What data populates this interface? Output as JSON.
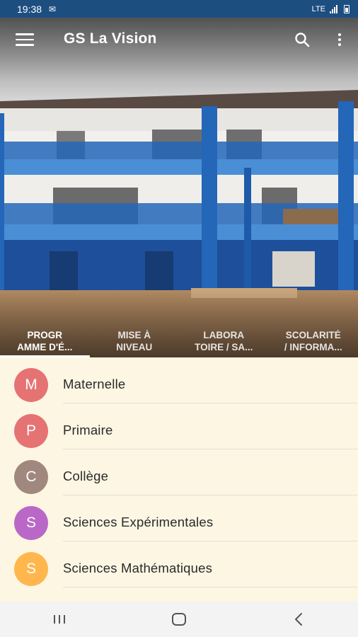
{
  "status_bar": {
    "time": "19:38",
    "notification_icon": "mail-icon",
    "network": "LTE"
  },
  "app_bar": {
    "title": "GS La Vision",
    "menu_icon": "menu-icon",
    "search_icon": "search-icon",
    "more_icon": "more-vert-icon"
  },
  "tabs": [
    {
      "line1": "PROGR",
      "line2": "AMME D'É...",
      "active": true
    },
    {
      "line1": "MISE À",
      "line2": "NIVEAU",
      "active": false
    },
    {
      "line1": "LABORA",
      "line2": "TOIRE / SA...",
      "active": false
    },
    {
      "line1": "SCOLARITÉ",
      "line2": "/ INFORMA...",
      "active": false
    }
  ],
  "list": {
    "items": [
      {
        "letter": "M",
        "label": "Maternelle",
        "color": "#e57373"
      },
      {
        "letter": "P",
        "label": "Primaire",
        "color": "#e57373"
      },
      {
        "letter": "C",
        "label": "Collège",
        "color": "#a1887f"
      },
      {
        "letter": "S",
        "label": "Sciences Expérimentales",
        "color": "#ba68c8"
      },
      {
        "letter": "S",
        "label": "Sciences Mathématiques",
        "color": "#ffb74d"
      }
    ]
  },
  "colors": {
    "status_bar": "#1d4e80",
    "list_background": "#fdf6e3",
    "building_blue": "#2466b8"
  },
  "nav_bar": {
    "recents_icon": "recents-icon",
    "home_icon": "home-icon",
    "back_icon": "back-icon"
  }
}
